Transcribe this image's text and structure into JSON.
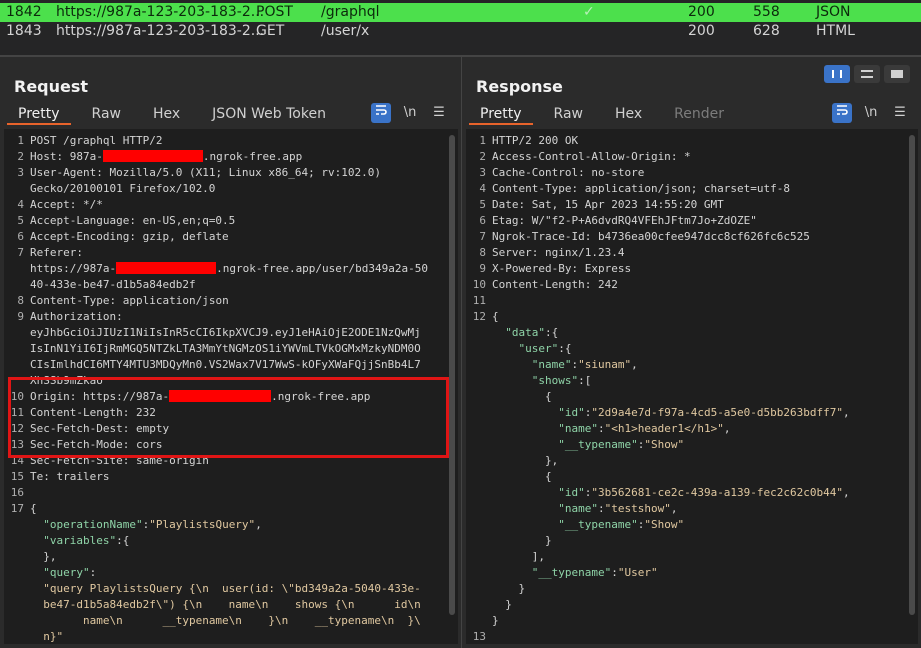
{
  "history": {
    "rows": [
      {
        "id": "1842",
        "url": "https://987a-123-203-183-2...",
        "method": "POST",
        "path": "/graphql",
        "check": "✓",
        "status": "200",
        "length": "558",
        "mime": "JSON",
        "selected": true
      },
      {
        "id": "1843",
        "url": "https://987a-123-203-183-2...",
        "method": "GET",
        "path": "/user/x",
        "check": "",
        "status": "200",
        "length": "628",
        "mime": "HTML",
        "selected": false
      }
    ]
  },
  "request": {
    "title": "Request",
    "tabs": [
      "Pretty",
      "Raw",
      "Hex",
      "JSON Web Token"
    ],
    "active_tab": "Pretty",
    "wrap_icon": "wrap-icon",
    "newline_label": "\\n",
    "menu_icon": "menu-icon",
    "lines": [
      {
        "n": "1",
        "t": "POST /graphql HTTP/2"
      },
      {
        "n": "2",
        "k": "Host",
        "v": ": 987a-",
        "redact_w": 100,
        "v2": ".ngrok-free.app"
      },
      {
        "n": "3",
        "k": "User-Agent",
        "v": ": Mozilla/5.0 (X11; Linux x86_64; rv:102.0)"
      },
      {
        "n": "",
        "t": "Gecko/20100101 Firefox/102.0"
      },
      {
        "n": "4",
        "k": "Accept",
        "v": ": */*"
      },
      {
        "n": "5",
        "k": "Accept-Language",
        "v": ": en-US,en;q=0.5"
      },
      {
        "n": "6",
        "k": "Accept-Encoding",
        "v": ": gzip, deflate"
      },
      {
        "n": "7",
        "k": "Referer",
        "v": ":"
      },
      {
        "n": "",
        "t": "https://987a-",
        "redact_w": 100,
        "v2": ".ngrok-free.app/user/bd349a2a-50"
      },
      {
        "n": "",
        "t": "40-433e-be47-d1b5a84edb2f"
      },
      {
        "n": "8",
        "k": "Content-Type",
        "v": ": application/json"
      },
      {
        "n": "9",
        "k": "Authorization",
        "v": ":"
      },
      {
        "n": "",
        "t": "eyJhbGciOiJIUzI1NiIsInR5cCI6IkpXVCJ9.eyJ1eHAiOjE2ODE1NzQwMj"
      },
      {
        "n": "",
        "t": "IsInN1YiI6IjRmMGQ5NTZkLTA3MmYtNGMzOS1iYWVmLTVkOGMxMzkyNDM0O"
      },
      {
        "n": "",
        "t": "CIsImlhdCI6MTY4MTU3MDQyMn0.VS2Wax7V17WwS-kOFyXWaFQjjSnBb4L7"
      },
      {
        "n": "",
        "t": "XhSSb9mZkao"
      },
      {
        "n": "10",
        "k": "Origin",
        "v": ": https://987a-",
        "redact_w": 102,
        "v2": ".ngrok-free.app"
      },
      {
        "n": "11",
        "k": "Content-Length",
        "v": ": 232"
      },
      {
        "n": "12",
        "k": "Sec-Fetch-Dest",
        "v": ": empty"
      },
      {
        "n": "13",
        "k": "Sec-Fetch-Mode",
        "v": ": cors"
      },
      {
        "n": "14",
        "k": "Sec-Fetch-Site",
        "v": ": same-origin"
      },
      {
        "n": "15",
        "k": "Te",
        "v": ": trailers"
      },
      {
        "n": "16",
        "t": ""
      },
      {
        "n": "17",
        "t": "{"
      },
      {
        "n": "",
        "json": [
          [
            "  ",
            "p"
          ],
          [
            "\"operationName\"",
            "k"
          ],
          [
            ":",
            "p"
          ],
          [
            "\"PlaylistsQuery\"",
            "s"
          ],
          [
            ",",
            "p"
          ]
        ]
      },
      {
        "n": "",
        "json": [
          [
            "  ",
            "p"
          ],
          [
            "\"variables\"",
            "k"
          ],
          [
            ":{",
            "p"
          ]
        ]
      },
      {
        "n": "",
        "json": [
          [
            "  },",
            "p"
          ]
        ]
      },
      {
        "n": "",
        "json": [
          [
            "  ",
            "p"
          ],
          [
            "\"query\"",
            "k"
          ],
          [
            ":",
            "p"
          ]
        ]
      },
      {
        "n": "",
        "json": [
          [
            "  ",
            "p"
          ],
          [
            "\"query PlaylistsQuery {\\n  user(id: \\\"bd349a2a-5040-433e-",
            "s"
          ]
        ]
      },
      {
        "n": "",
        "json": [
          [
            "  ",
            "p"
          ],
          [
            "be47-d1b5a84edb2f\\\") {\\n    name\\n    shows {\\n      id\\n",
            "s"
          ]
        ]
      },
      {
        "n": "",
        "json": [
          [
            "  ",
            "p"
          ],
          [
            "      name\\n      __typename\\n    }\\n    __typename\\n  }\\",
            "s"
          ]
        ]
      },
      {
        "n": "",
        "json": [
          [
            "  ",
            "p"
          ],
          [
            "n}\"",
            "s"
          ]
        ]
      }
    ]
  },
  "response": {
    "title": "Response",
    "tabs": [
      "Pretty",
      "Raw",
      "Hex",
      "Render"
    ],
    "active_tab": "Pretty",
    "disabled_tab": "Render",
    "newline_label": "\\n",
    "lines": [
      {
        "n": "1",
        "t": "HTTP/2 200 OK"
      },
      {
        "n": "2",
        "k": "Access-Control-Allow-Origin",
        "v": ": *"
      },
      {
        "n": "3",
        "k": "Cache-Control",
        "v": ": no-store"
      },
      {
        "n": "4",
        "k": "Content-Type",
        "v": ": application/json; charset=utf-8"
      },
      {
        "n": "5",
        "k": "Date",
        "v": ": Sat, 15 Apr 2023 14:55:20 GMT"
      },
      {
        "n": "6",
        "k": "Etag",
        "v": ": W/\"f2-P+A6dvdRQ4VFEhJFtm7Jo+ZdOZE\""
      },
      {
        "n": "7",
        "k": "Ngrok-Trace-Id",
        "v": ": b4736ea00cfee947dcc8cf626fc6c525"
      },
      {
        "n": "8",
        "k": "Server",
        "v": ": nginx/1.23.4"
      },
      {
        "n": "9",
        "k": "X-Powered-By",
        "v": ": Express"
      },
      {
        "n": "10",
        "k": "Content-Length",
        "v": ": 242"
      },
      {
        "n": "11",
        "t": ""
      },
      {
        "n": "12",
        "t": "{"
      },
      {
        "n": "",
        "json": [
          [
            "  ",
            "p"
          ],
          [
            "\"data\"",
            "k"
          ],
          [
            ":{",
            "p"
          ]
        ]
      },
      {
        "n": "",
        "json": [
          [
            "    ",
            "p"
          ],
          [
            "\"user\"",
            "k"
          ],
          [
            ":{",
            "p"
          ]
        ]
      },
      {
        "n": "",
        "json": [
          [
            "      ",
            "p"
          ],
          [
            "\"name\"",
            "k"
          ],
          [
            ":",
            "p"
          ],
          [
            "\"siunam\"",
            "s"
          ],
          [
            ",",
            "p"
          ]
        ]
      },
      {
        "n": "",
        "json": [
          [
            "      ",
            "p"
          ],
          [
            "\"shows\"",
            "k"
          ],
          [
            ":[",
            "p"
          ]
        ]
      },
      {
        "n": "",
        "json": [
          [
            "        {",
            "p"
          ]
        ]
      },
      {
        "n": "",
        "json": [
          [
            "          ",
            "p"
          ],
          [
            "\"id\"",
            "k"
          ],
          [
            ":",
            "p"
          ],
          [
            "\"2d9a4e7d-f97a-4cd5-a5e0-d5bb263bdff7\"",
            "s"
          ],
          [
            ",",
            "p"
          ]
        ]
      },
      {
        "n": "",
        "json": [
          [
            "          ",
            "p"
          ],
          [
            "\"name\"",
            "k"
          ],
          [
            ":",
            "p"
          ],
          [
            "\"<h1>header1</h1>\"",
            "s"
          ],
          [
            ",",
            "p"
          ]
        ]
      },
      {
        "n": "",
        "json": [
          [
            "          ",
            "p"
          ],
          [
            "\"__typename\"",
            "k"
          ],
          [
            ":",
            "p"
          ],
          [
            "\"Show\"",
            "s"
          ]
        ]
      },
      {
        "n": "",
        "json": [
          [
            "        },",
            "p"
          ]
        ]
      },
      {
        "n": "",
        "json": [
          [
            "        {",
            "p"
          ]
        ]
      },
      {
        "n": "",
        "json": [
          [
            "          ",
            "p"
          ],
          [
            "\"id\"",
            "k"
          ],
          [
            ":",
            "p"
          ],
          [
            "\"3b562681-ce2c-439a-a139-fec2c62c0b44\"",
            "s"
          ],
          [
            ",",
            "p"
          ]
        ]
      },
      {
        "n": "",
        "json": [
          [
            "          ",
            "p"
          ],
          [
            "\"name\"",
            "k"
          ],
          [
            ":",
            "p"
          ],
          [
            "\"testshow\"",
            "s"
          ],
          [
            ",",
            "p"
          ]
        ]
      },
      {
        "n": "",
        "json": [
          [
            "          ",
            "p"
          ],
          [
            "\"__typename\"",
            "k"
          ],
          [
            ":",
            "p"
          ],
          [
            "\"Show\"",
            "s"
          ]
        ]
      },
      {
        "n": "",
        "json": [
          [
            "        }",
            "p"
          ]
        ]
      },
      {
        "n": "",
        "json": [
          [
            "      ],",
            "p"
          ]
        ]
      },
      {
        "n": "",
        "json": [
          [
            "      ",
            "p"
          ],
          [
            "\"__typename\"",
            "k"
          ],
          [
            ":",
            "p"
          ],
          [
            "\"User\"",
            "s"
          ]
        ]
      },
      {
        "n": "",
        "json": [
          [
            "    }",
            "p"
          ]
        ]
      },
      {
        "n": "",
        "json": [
          [
            "  }",
            "p"
          ]
        ]
      },
      {
        "n": "",
        "json": [
          [
            "}",
            "p"
          ]
        ]
      },
      {
        "n": "13",
        "t": ""
      }
    ]
  },
  "view_buttons": [
    "split-horizontal-icon",
    "split-vertical-icon",
    "single-view-icon"
  ]
}
